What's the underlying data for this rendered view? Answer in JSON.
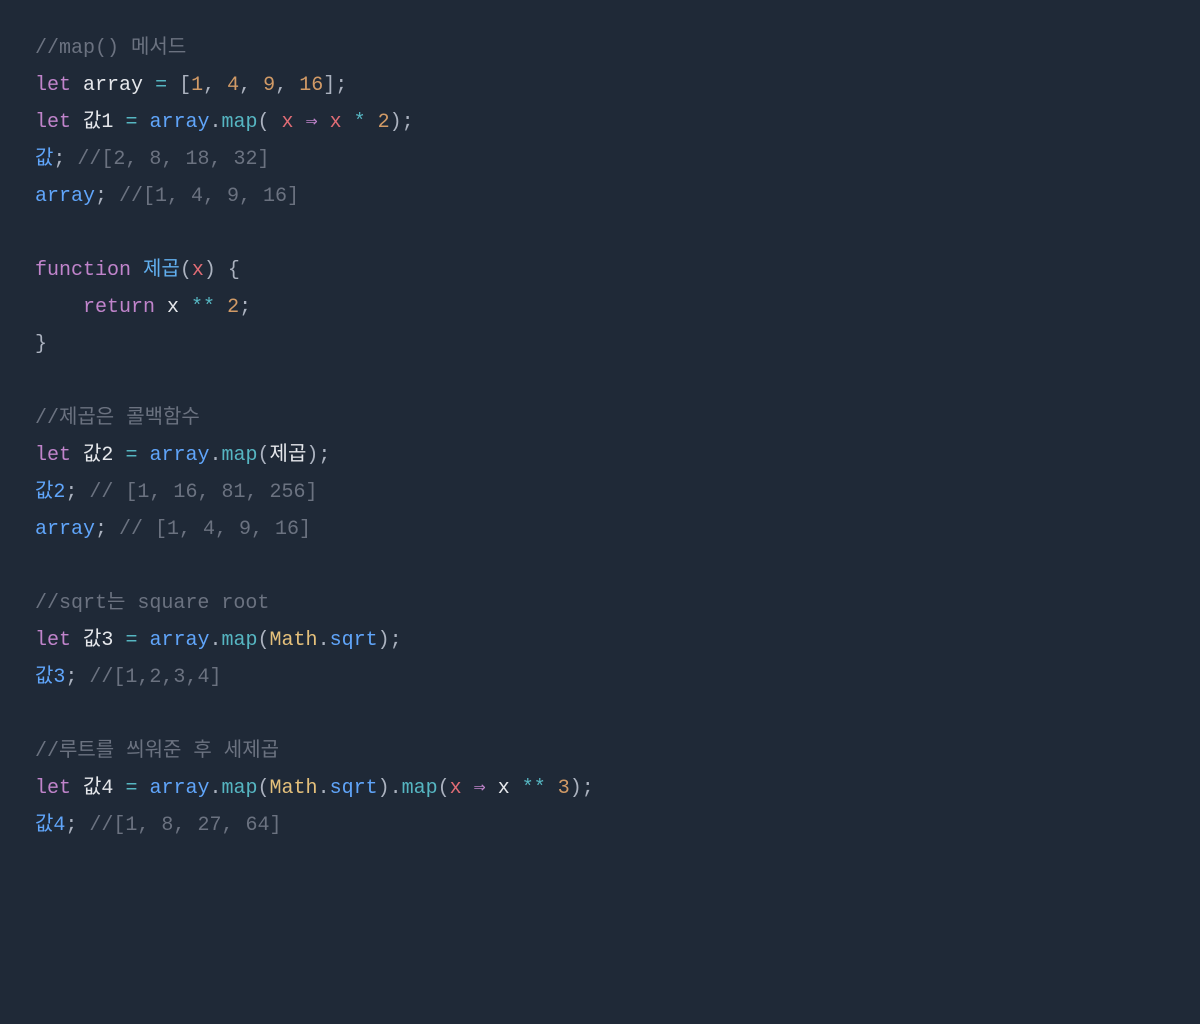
{
  "code": {
    "line1_comment": "//map() 메서드",
    "line2_let": "let",
    "line2_var": "array",
    "line2_eq": "=",
    "line2_open": "[",
    "line2_n1": "1",
    "line2_c1": ", ",
    "line2_n2": "4",
    "line2_c2": ", ",
    "line2_n3": "9",
    "line2_c3": ", ",
    "line2_n4": "16",
    "line2_close": "];",
    "line3_let": "let",
    "line3_var": "값1",
    "line3_eq": "=",
    "line3_arr": "array",
    "line3_dot": ".",
    "line3_map": "map",
    "line3_open": "( ",
    "line3_x1": "x",
    "line3_arrow": " ⇒ ",
    "line3_x2": "x",
    "line3_mult": " * ",
    "line3_two": "2",
    "line3_close": ");",
    "line4_val": "값",
    "line4_semi": "; ",
    "line4_comment": "//[2, 8, 18, 32]",
    "line5_arr": "array",
    "line5_semi": "; ",
    "line5_comment": "//[1, 4, 9, 16]",
    "line7_func": "function",
    "line7_name": " 제곱",
    "line7_open": "(",
    "line7_param": "x",
    "line7_close": ") {",
    "line8_indent": "    ",
    "line8_return": "return",
    "line8_x": " x",
    "line8_pow": " ** ",
    "line8_two": "2",
    "line8_semi": ";",
    "line9_close": "}",
    "line11_comment": "//제곱은 콜백함수",
    "line12_let": "let",
    "line12_var": "값2",
    "line12_eq": "=",
    "line12_arr": "array",
    "line12_dot": ".",
    "line12_map": "map",
    "line12_open": "(",
    "line12_cb": "제곱",
    "line12_close": ");",
    "line13_val": "값2",
    "line13_semi": "; ",
    "line13_comment": "// [1, 16, 81, 256]",
    "line14_arr": "array",
    "line14_semi": "; ",
    "line14_comment": "// [1, 4, 9, 16]",
    "line16_comment": "//sqrt는 square root",
    "line17_let": "let",
    "line17_var": "값3",
    "line17_eq": "=",
    "line17_arr": "array",
    "line17_dot": ".",
    "line17_map": "map",
    "line17_open": "(",
    "line17_math": "Math",
    "line17_dot2": ".",
    "line17_sqrt": "sqrt",
    "line17_close": ");",
    "line18_val": "값3",
    "line18_semi": "; ",
    "line18_comment": "//[1,2,3,4]",
    "line20_comment": "//루트를 씌워준 후 세제곱",
    "line21_let": "let",
    "line21_var": "값4",
    "line21_eq": "=",
    "line21_arr": "array",
    "line21_dot": ".",
    "line21_map": "map",
    "line21_open": "(",
    "line21_math": "Math",
    "line21_dot2": ".",
    "line21_sqrt": "sqrt",
    "line21_close": ")",
    "line21_dot3": ".",
    "line21_map2": "map",
    "line21_open2": "(",
    "line21_x1": "x",
    "line21_arrow": " ⇒ ",
    "line21_x2": "x",
    "line21_pow": " ** ",
    "line21_three": "3",
    "line21_close2": ");",
    "line22_val": "값4",
    "line22_semi": "; ",
    "line22_comment": "//[1, 8, 27, 64]"
  }
}
